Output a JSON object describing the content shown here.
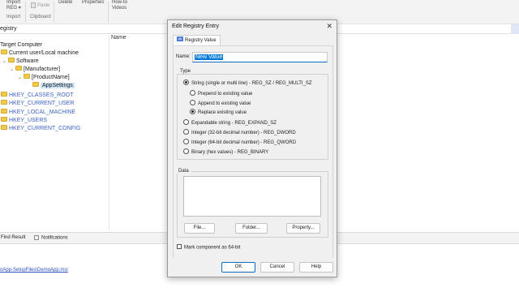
{
  "ribbon": {
    "import_label": "Import",
    "reg_label": "REG",
    "paste_label": "Paste",
    "delete_label": "Delete",
    "properties_label": "Properties",
    "howto_line1": "How-to",
    "howto_line2": "Videos",
    "group_import": "Import",
    "group_clipboard": "Clipboard"
  },
  "path": {
    "text": "egistry"
  },
  "tree": {
    "root": "Target Computer",
    "current_user": "Current user/Local machine",
    "software": "Software",
    "manufacturer": "[Manufacturer]",
    "product": "[ProductName]",
    "appsettings": "AppSettings",
    "hkeys": [
      "HKEY_CLASSES_ROOT",
      "HKEY_CURRENT_USER",
      "HKEY_LOCAL_MACHINE",
      "HKEY_USERS",
      "HKEY_CURRENT_CONFIG"
    ]
  },
  "list": {
    "name_header": "Name"
  },
  "bottom": {
    "find_result": "Find Result",
    "notifications": "Notifications",
    "output_link": "oApp-SetupFiles\\DemoApp.msi"
  },
  "dialog": {
    "title": "Edit Registry Entry",
    "close": "✕",
    "tab_label": "Registry Value",
    "tab_icon_text": "ab",
    "name_label": "Name:",
    "name_value": "New Value",
    "type_label": "Type",
    "types": [
      "String (single or multi line) - REG_SZ / REG_MULTI_SZ",
      "Prepend to existing value",
      "Append to existing value",
      "Replace existing value",
      "Expandable string - REG_EXPAND_SZ",
      "Integer (32-bit decimal number) - REG_DWORD",
      "Integer (64-bit decimal number) - REG_QWORD",
      "Binary (hex values) - REG_BINARY"
    ],
    "data_label": "Data",
    "file_btn": "File...",
    "folder_btn": "Folder...",
    "property_btn": "Property...",
    "mark64_label": "Mark component as 64-bit",
    "ok": "OK",
    "cancel": "Cancel",
    "help": "Help"
  }
}
